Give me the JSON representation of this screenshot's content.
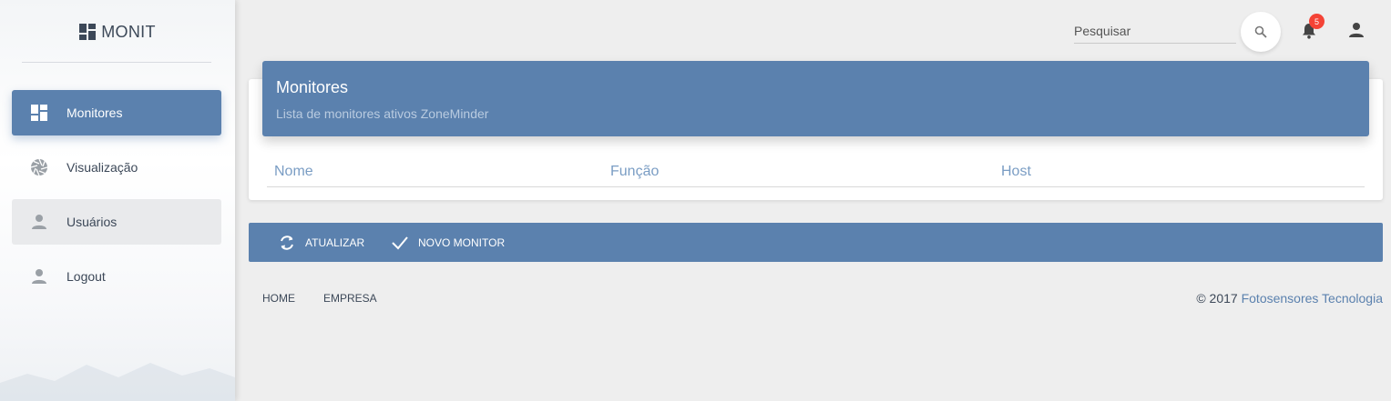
{
  "sidebar": {
    "logo": "MONIT",
    "items": [
      {
        "label": "Monitores",
        "icon": "dashboard-icon",
        "state": "active"
      },
      {
        "label": "Visualização",
        "icon": "camera-shutter-icon",
        "state": "normal"
      },
      {
        "label": "Usuários",
        "icon": "person-icon",
        "state": "hover"
      },
      {
        "label": "Logout",
        "icon": "person-icon",
        "state": "normal"
      }
    ]
  },
  "topbar": {
    "search_placeholder": "Pesquisar",
    "notification_count": "5"
  },
  "card": {
    "title": "Monitores",
    "subtitle": "Lista de monitores ativos ZoneMinder",
    "columns": [
      "Nome",
      "Função",
      "Host"
    ]
  },
  "actions": {
    "refresh_label": "ATUALIZAR",
    "new_label": "NOVO MONITOR"
  },
  "footer": {
    "links": [
      "HOME",
      "EMPRESA"
    ],
    "copyright_prefix": "© 2017 ",
    "copyright_brand": "Fotosensores Tecnologia"
  },
  "colors": {
    "accent": "#5b81ae",
    "badge": "#f44336",
    "background": "#eeeeee"
  }
}
